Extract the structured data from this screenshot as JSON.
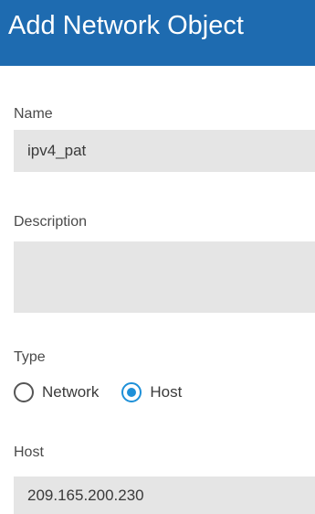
{
  "dialog": {
    "title": "Add Network Object"
  },
  "form": {
    "name": {
      "label": "Name",
      "value": "ipv4_pat"
    },
    "description": {
      "label": "Description",
      "value": ""
    },
    "type": {
      "label": "Type",
      "options": [
        {
          "label": "Network",
          "selected": false
        },
        {
          "label": "Host",
          "selected": true
        }
      ]
    },
    "host": {
      "label": "Host",
      "value": "209.165.200.230"
    }
  },
  "colors": {
    "header_background": "#1e6bb0",
    "field_background": "#e5e5e5",
    "radio_selected": "#1e90d8"
  }
}
